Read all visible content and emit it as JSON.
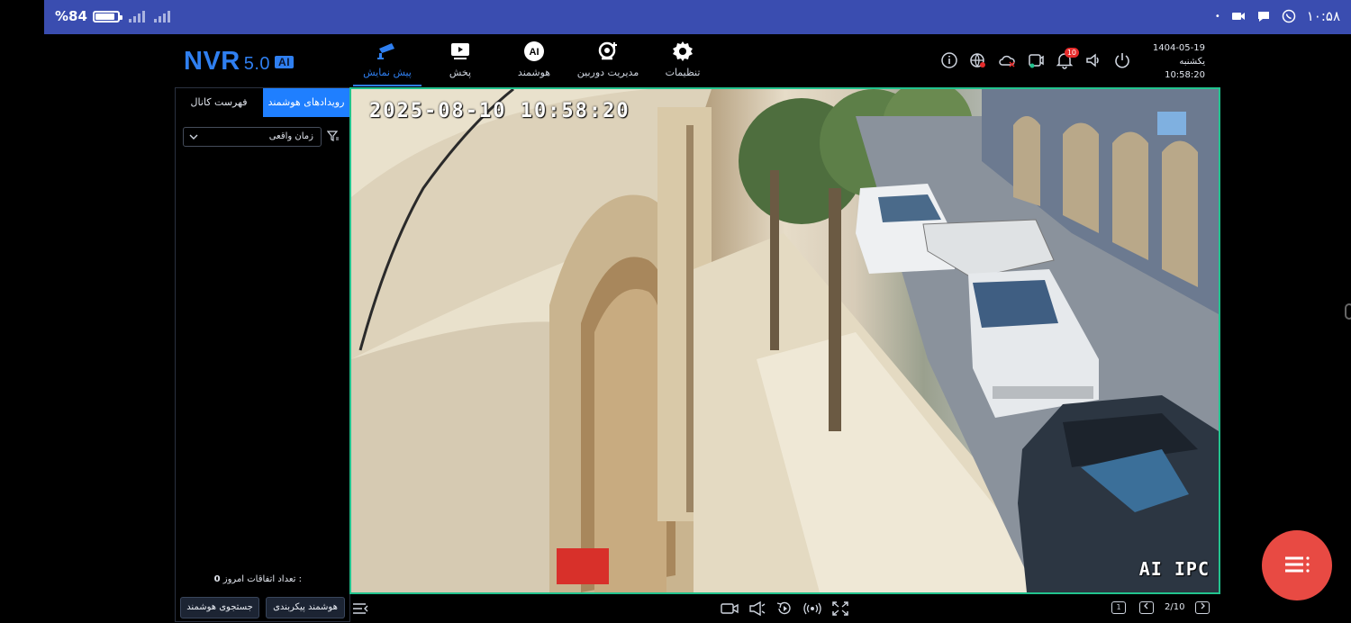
{
  "status_bar": {
    "battery_percent": "%84",
    "battery_level": 0.84,
    "time": "۱۰:۵۸"
  },
  "app": {
    "logo_name": "NVR",
    "logo_version": "5.0",
    "logo_badge": "AI"
  },
  "nav": {
    "items": [
      {
        "label": "تنظیمات",
        "icon": "gear-icon"
      },
      {
        "label": "مدیریت دوربین",
        "icon": "camera-add-icon"
      },
      {
        "label": "هوشمند",
        "icon": "ai-icon"
      },
      {
        "label": "پخش",
        "icon": "playback-icon"
      },
      {
        "label": "پیش نمایش",
        "icon": "cctv-camera-icon",
        "active": true
      }
    ]
  },
  "header": {
    "notification_count": "10",
    "date": "1404-05-19",
    "weekday": "یکشنبه",
    "time": "10:58:20"
  },
  "left_panel": {
    "tabs": [
      "رویدادهای هوشمند",
      "فهرست کانال"
    ],
    "active_tab": "رویدادهای هوشمند",
    "filter_select_value": "زمان واقعی",
    "events_count_label": "تعداد اتفاقات امروز :",
    "events_count_value": "0",
    "buttons": {
      "smart_search": "جستجوی هوشمند",
      "smart_config": "هوشمند پیکربندی"
    }
  },
  "video": {
    "osd_timestamp": "2025-08-10 10:58:20",
    "osd_channel_name": "AI IPC"
  },
  "bottom_bar": {
    "page_indicator": "2/10",
    "first_page_label": "1"
  },
  "colors": {
    "accent": "#1f7fff",
    "status_bar": "#3a4db0",
    "video_border": "#22c38e",
    "fab": "#e84a43",
    "badge": "#e52b2b"
  }
}
